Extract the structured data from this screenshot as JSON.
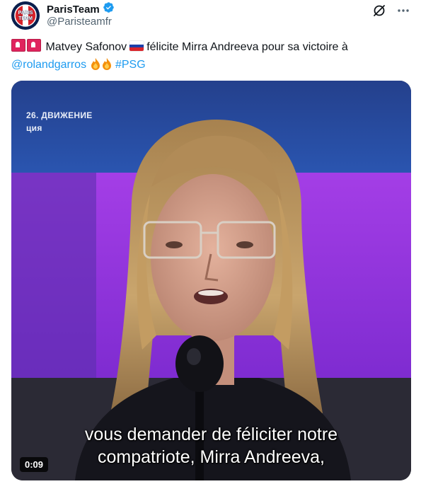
{
  "author": {
    "display_name": "ParisTeam",
    "handle": "@Paristeamfr",
    "verified": true,
    "avatar_text": [
      "PARIS",
      "TEAM"
    ],
    "avatar_colors": {
      "background": "#0a1f4d",
      "red": "#d8232a"
    }
  },
  "header_icons": [
    "grok-icon",
    "more-icon"
  ],
  "tweet": {
    "siren_emoji_count": 2,
    "segment_1": "Matvey Safonov",
    "flag": "russia-flag",
    "segment_2": "félicite Mirra Andreeva pour sa victoire à",
    "mention": "@rolandgarros",
    "fire_emoji_count": 2,
    "hashtag": "#PSG"
  },
  "video": {
    "channel_lines": [
      "26. ДВИЖЕНИЕ",
      "ция"
    ],
    "subtitle_lines": [
      "vous demander de féliciter notre",
      "compatriote, Mirra Andreeva,"
    ],
    "duration": "0:09"
  },
  "colors": {
    "link": "#1d9bf0",
    "verified": "#1d9bf0",
    "text": "#0f1419",
    "secondary": "#536471"
  }
}
